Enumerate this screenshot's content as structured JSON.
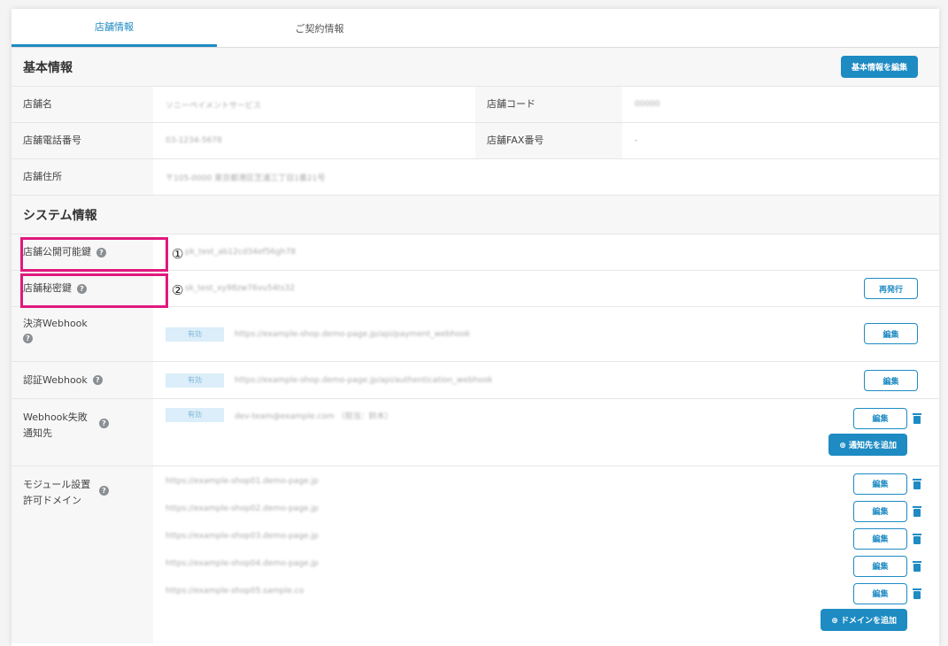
{
  "tabs": [
    {
      "label": "店舗情報"
    },
    {
      "label": "ご契約情報"
    }
  ],
  "basic": {
    "title": "基本情報",
    "edit_button": "基本情報を編集",
    "shop_name_label": "店舗名",
    "shop_name_value": "ソニーペイメントサービス",
    "shop_code_label": "店舗コード",
    "shop_code_value": "00000",
    "phone_label": "店舗電話番号",
    "phone_value": "03-1234-5678",
    "fax_label": "店舗FAX番号",
    "fax_value": "-",
    "address_label": "店舗住所",
    "address_value": "〒105-0000 東京都港区芝浦三丁目1番21号"
  },
  "system": {
    "title": "システム情報",
    "public_key_label": "店舗公開可能鍵",
    "public_key_value": "pk_test_ab12cd34ef56gh78",
    "secret_key_label": "店舗秘密鍵",
    "secret_key_value": "sk_test_xy98zw76vu54ts32",
    "reissue_button": "再発行",
    "payment_webhook_label": "決済Webhook",
    "payment_webhook_status": "有効",
    "payment_webhook_url": "https://example-shop.demo-page.jp/api/payment_webhook",
    "auth_webhook_label": "認証Webhook",
    "auth_webhook_status": "有効",
    "auth_webhook_url": "https://example-shop.demo-page.jp/api/authentication_webhook",
    "fail_notify_label": "Webhook失敗通知先",
    "fail_notify_status": "有効",
    "fail_notify_value": "dev-team@example.com （担当：鈴木）",
    "edit_label": "編集",
    "add_notify_button": "通知先を追加",
    "domain_label": "モジュール設置許可ドメイン",
    "domains": [
      {
        "url": "https://example-shop01.demo-page.jp"
      },
      {
        "url": "https://example-shop02.demo-page.jp"
      },
      {
        "url": "https://example-shop03.demo-page.jp"
      },
      {
        "url": "https://example-shop04.demo-page.jp"
      },
      {
        "url": "https://example-shop05.sample.co"
      }
    ],
    "add_domain_button": "ドメインを追加"
  },
  "annotations": {
    "marker_1": "①",
    "marker_2": "②",
    "highlight_color": "#e0197d"
  },
  "colors": {
    "accent": "#1e8bc3",
    "label_bg": "#f7f7f7"
  }
}
